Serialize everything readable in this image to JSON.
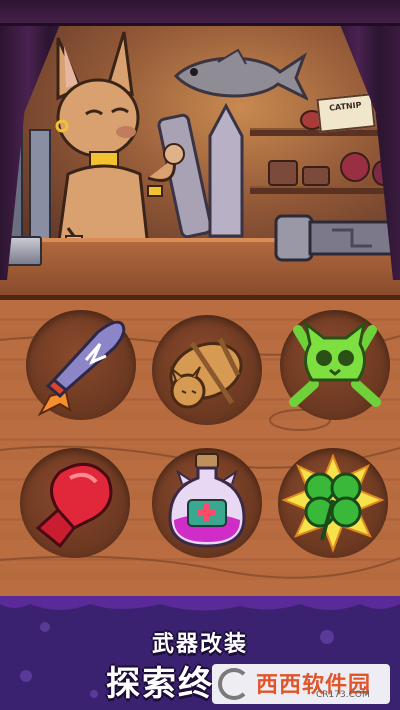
{
  "shop": {
    "sign_text": "CATNIP"
  },
  "items": [
    {
      "name": "rocket-bullet",
      "icon": "rocket-bullet-icon"
    },
    {
      "name": "sleeping-cat-bundle",
      "icon": "tied-cat-icon"
    },
    {
      "name": "cat-skull",
      "icon": "green-cat-skull-icon"
    },
    {
      "name": "boxing-glove",
      "icon": "red-boxing-glove-icon"
    },
    {
      "name": "health-potion",
      "icon": "cat-potion-icon"
    },
    {
      "name": "lucky-clover",
      "icon": "four-leaf-clover-icon"
    }
  ],
  "banner": {
    "line1": "武器改装",
    "line2": "探索终"
  },
  "watermark": {
    "brand": "西西软件园",
    "url": "CR173.COM"
  },
  "colors": {
    "board": "#b96d40",
    "banner": "#3a2270",
    "watermark_accent": "#e0552a"
  }
}
